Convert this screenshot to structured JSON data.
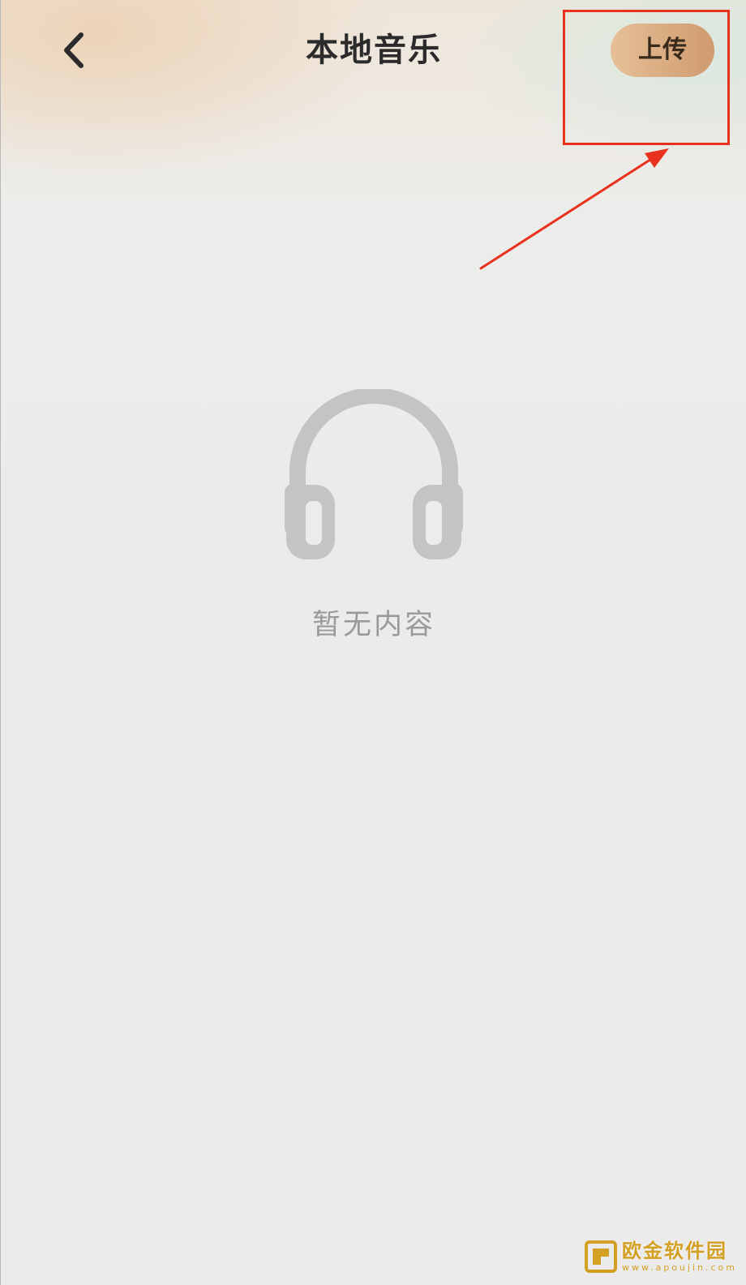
{
  "header": {
    "title": "本地音乐",
    "upload_label": "上传"
  },
  "empty_state": {
    "message": "暂无内容"
  },
  "watermark": {
    "title": "欧金软件园",
    "url": "www.apoujin.com"
  },
  "icons": {
    "back": "chevron-left-icon",
    "empty": "headphones-icon",
    "watermark": "logo-icon"
  },
  "colors": {
    "upload_gradient_start": "#e6bf97",
    "upload_gradient_end": "#cf9b6e",
    "annotation_red": "#e8321d",
    "empty_icon_gray": "#c4c4c4",
    "empty_text_gray": "#9a9a9a",
    "watermark_gold": "#d4a024"
  }
}
